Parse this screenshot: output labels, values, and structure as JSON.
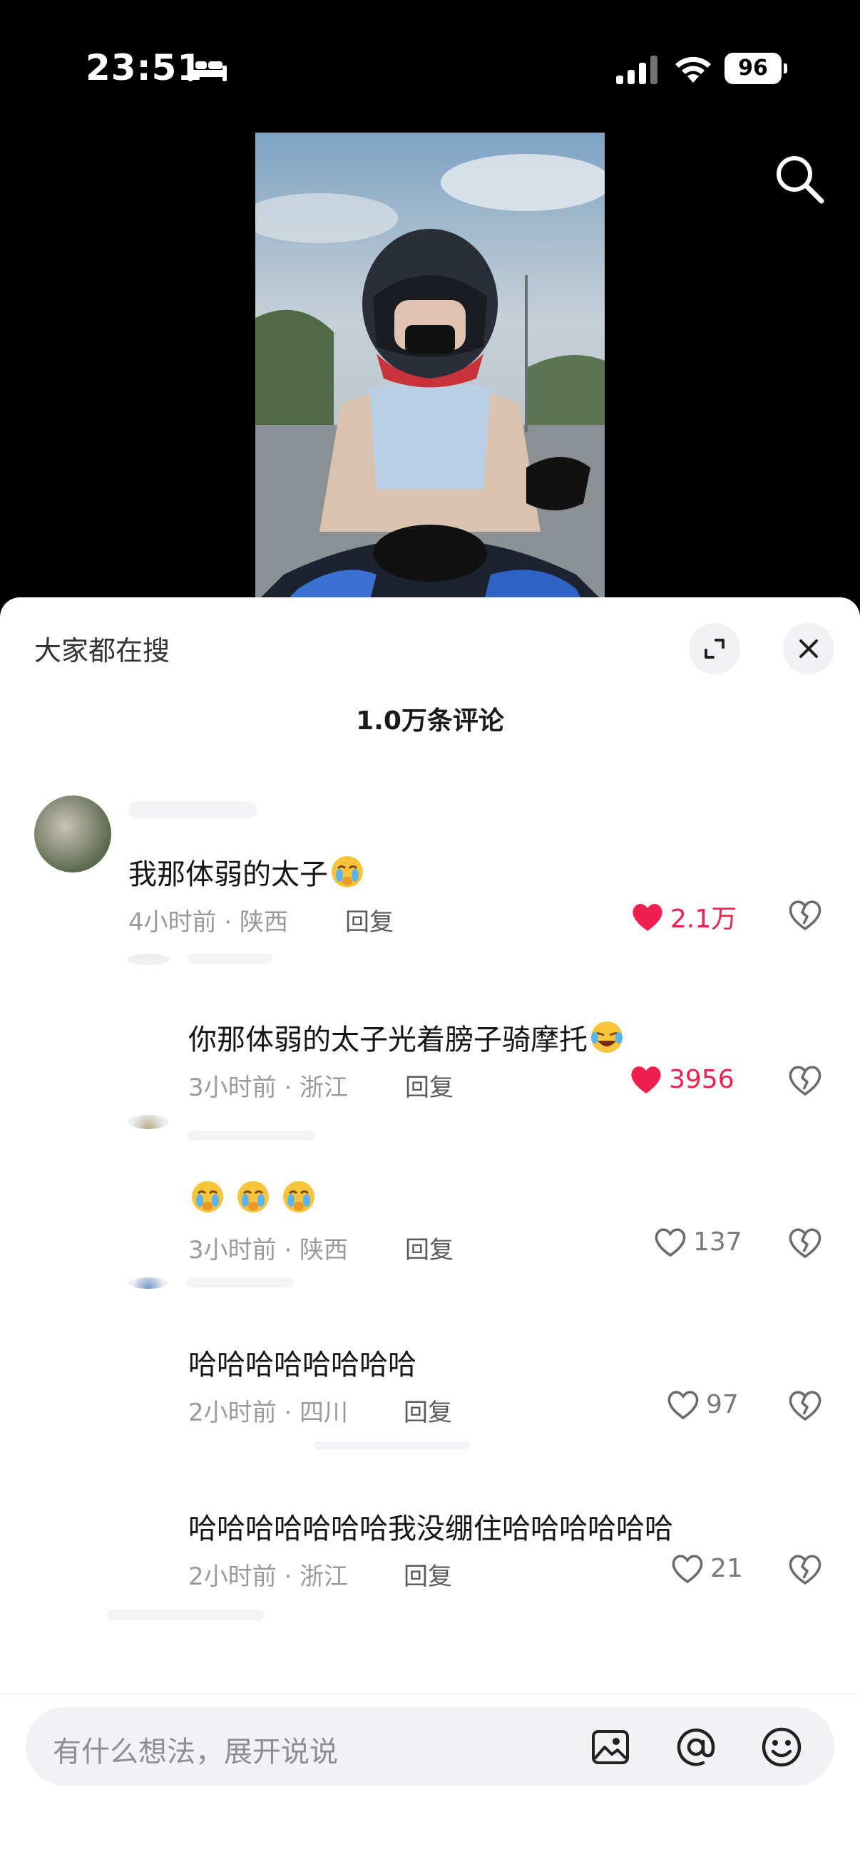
{
  "status_bar": {
    "time": "23:51",
    "battery": "96"
  },
  "sheet": {
    "search_text": "大家都在搜",
    "comment_count": "1.0万条评论"
  },
  "comments": [
    {
      "text": "我那体弱的太子",
      "time_loc": "4小时前 · 陕西",
      "reply": "回复",
      "likes": "2.1万",
      "liked": true
    },
    {
      "text": "你那体弱的太子光着膀子骑摩托",
      "time_loc": "3小时前 · 浙江",
      "reply": "回复",
      "likes": "3956",
      "liked": true
    },
    {
      "text": "",
      "time_loc": "3小时前 · 陕西",
      "reply": "回复",
      "likes": "137",
      "liked": false
    },
    {
      "text": "哈哈哈哈哈哈哈哈",
      "time_loc": "2小时前 · 四川",
      "reply": "回复",
      "likes": "97",
      "liked": false
    },
    {
      "text": "哈哈哈哈哈哈哈我没绷住哈哈哈哈哈哈",
      "time_loc": "2小时前 · 浙江",
      "reply": "回复",
      "likes": "21",
      "liked": false
    }
  ],
  "input": {
    "placeholder": "有什么想法，展开说说"
  },
  "colors": {
    "like_red": "#f0204e",
    "sheet_bg": "#ffffff",
    "page_bg": "#000000"
  },
  "icons": [
    "bed-icon",
    "signal-icon",
    "wifi-icon",
    "search-icon",
    "expand-icon",
    "close-icon",
    "heart-icon",
    "dislike-icon",
    "image-icon",
    "at-icon",
    "emoji-icon"
  ]
}
